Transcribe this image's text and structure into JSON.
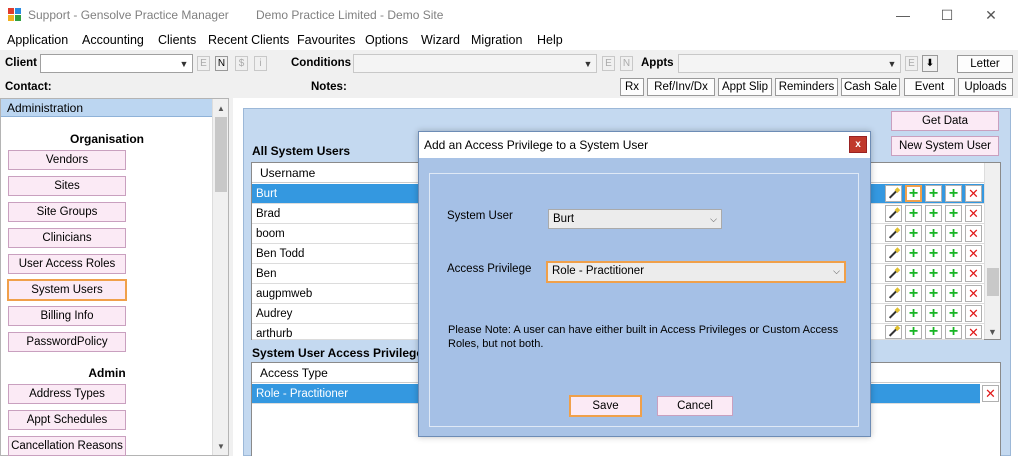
{
  "window": {
    "title": "Support - Gensolve Practice Manager",
    "subtitle": "Demo Practice Limited - Demo Site",
    "minimize": "—",
    "maximize": "☐",
    "close": "✕"
  },
  "menu": [
    "Application",
    "Accounting",
    "Clients",
    "Recent Clients",
    "Favourites",
    "Options",
    "Wizard",
    "Migration",
    "Help"
  ],
  "toolbar": {
    "client_label": "Client",
    "client_value": "",
    "client_btns": [
      "E",
      "N",
      "$",
      "i"
    ],
    "conditions_label": "Conditions",
    "conditions_btns": [
      "E",
      "N"
    ],
    "appts_label": "Appts",
    "appts_btn": "E",
    "letter": "Letter",
    "contact_label": "Contact:",
    "notes_label": "Notes:",
    "buttons": [
      "Rx",
      "Ref/Inv/Dx",
      "Appt Slip",
      "Reminders",
      "Cash Sale",
      "Event",
      "Uploads"
    ]
  },
  "left_panel": {
    "header": "Administration",
    "organisation_title": "Organisation",
    "organisation_items": [
      "Vendors",
      "Sites",
      "Site Groups",
      "Clinicians",
      "User Access Roles",
      "System Users",
      "Billing Info",
      "PasswordPolicy"
    ],
    "admin_title": "Admin",
    "admin_items": [
      "Address Types",
      "Appt Schedules",
      "Cancellation Reasons"
    ],
    "active_item": "System Users"
  },
  "main": {
    "get_data": "Get Data",
    "new_system_user": "New System User",
    "users_title": "All System Users",
    "users_header": "Username",
    "users": [
      "Burt",
      "Brad",
      "boom",
      "Ben Todd",
      "Ben",
      "augpmweb",
      "Audrey",
      "arthurb"
    ],
    "privileges_title": "System User Access Privileges",
    "privileges_header": "Access Type",
    "privileges": [
      "Role - Practitioner"
    ]
  },
  "dialog": {
    "title": "Add an Access Privilege to a  System User",
    "close": "x",
    "system_user_label": "System User",
    "system_user_value": "Burt",
    "access_privilege_label": "Access Privilege",
    "access_privilege_value": "Role - Practitioner",
    "note": "Please Note: A user can have either built in Access Privileges or Custom Access Roles, but not both.",
    "save": "Save",
    "cancel": "Cancel"
  },
  "colors": {
    "selection": "#3498e0",
    "highlight": "#f0a04a",
    "panel_blue": "#c4d9f0",
    "nav_pink": "#fbeaf5"
  }
}
